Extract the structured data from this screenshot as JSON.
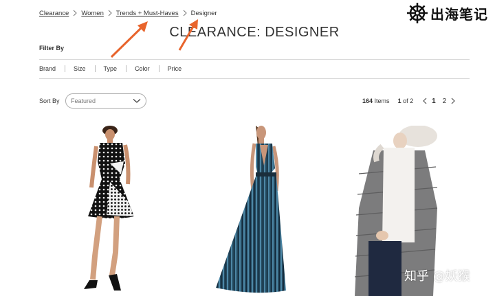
{
  "breadcrumb": {
    "items": [
      "Clearance",
      "Women",
      "Trends + Must-Haves"
    ],
    "current": "Designer"
  },
  "logo": {
    "text": "出海笔记"
  },
  "page_title": "CLEARANCE: DESIGNER",
  "filter_heading": "Filter By",
  "filters": [
    "Brand",
    "Size",
    "Type",
    "Color",
    "Price"
  ],
  "sort": {
    "label": "Sort By",
    "selected": "Featured"
  },
  "pagination": {
    "item_count": "164",
    "items_label": "Items",
    "page_current": "1",
    "page_of": "of 2",
    "pages": [
      "1",
      "2"
    ]
  },
  "annotation_color": "#e8642c",
  "watermark": "知乎 @妖猴",
  "products": [
    {
      "name": "polka-dot-dress"
    },
    {
      "name": "blue-striped-gown"
    },
    {
      "name": "grey-puffer-coat"
    }
  ]
}
